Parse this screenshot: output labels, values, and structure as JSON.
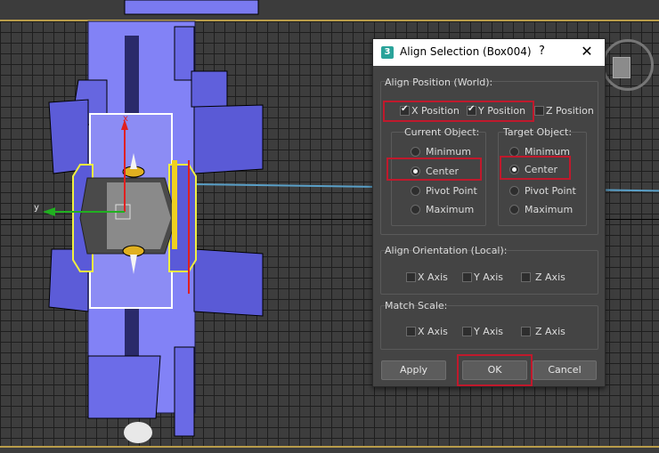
{
  "dialog": {
    "title": "Align Selection (Box004)",
    "help": "?",
    "close": "✕",
    "app_icon": "3",
    "align_position": {
      "label": "Align Position (World):",
      "x_position": "X Position",
      "y_position": "Y Position",
      "z_position": "Z Position",
      "current_object": {
        "label": "Current Object:",
        "options": [
          "Minimum",
          "Center",
          "Pivot Point",
          "Maximum"
        ],
        "selected": "Center"
      },
      "target_object": {
        "label": "Target Object:",
        "options": [
          "Minimum",
          "Center",
          "Pivot Point",
          "Maximum"
        ],
        "selected": "Center"
      }
    },
    "align_orientation": {
      "label": "Align Orientation (Local):",
      "x_axis": "X Axis",
      "y_axis": "Y Axis",
      "z_axis": "Z Axis"
    },
    "match_scale": {
      "label": "Match Scale:",
      "x_axis": "X Axis",
      "y_axis": "Y Axis",
      "z_axis": "Z Axis"
    },
    "buttons": {
      "apply": "Apply",
      "ok": "OK",
      "cancel": "Cancel"
    }
  },
  "viewport": {
    "axis_x_label": "x",
    "axis_y_label": "y"
  },
  "colors": {
    "highlight": "#c0192c",
    "model_blue": "#7878f0",
    "selection_white": "#ffffff"
  }
}
